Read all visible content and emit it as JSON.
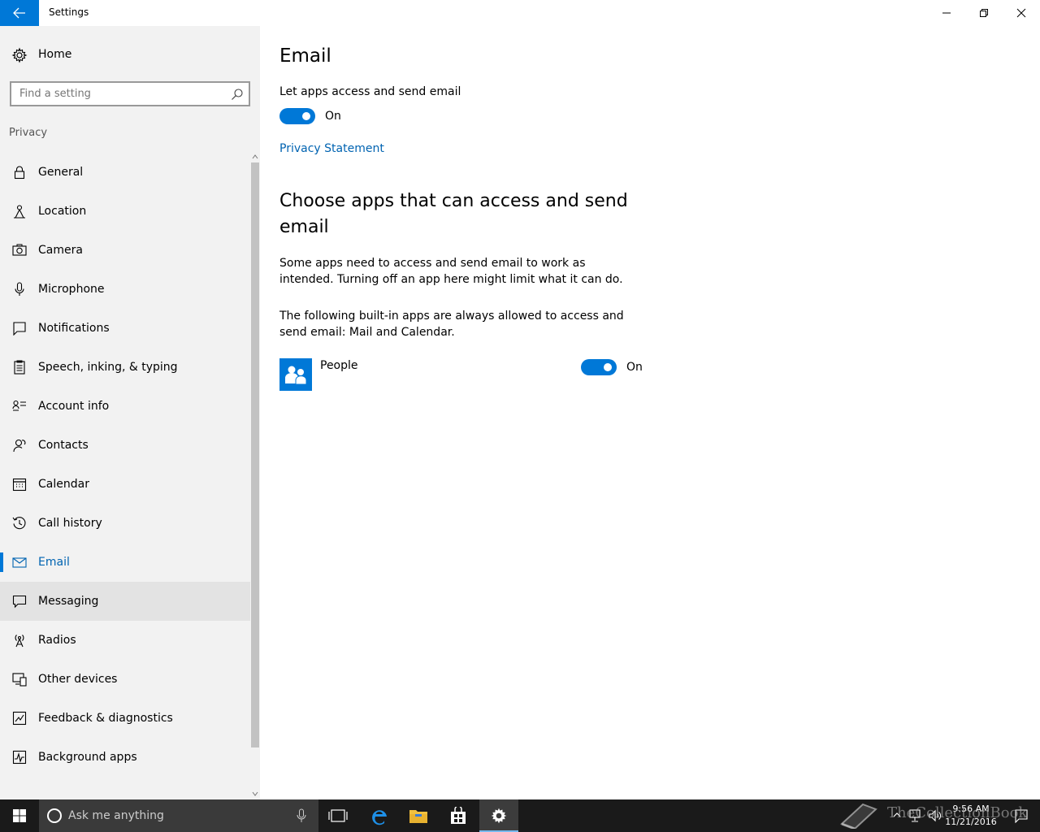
{
  "window": {
    "title": "Settings"
  },
  "sidebar": {
    "home_label": "Home",
    "search_placeholder": "Find a setting",
    "section_label": "Privacy",
    "items": [
      {
        "label": "General",
        "icon": "lock-icon"
      },
      {
        "label": "Location",
        "icon": "location-icon"
      },
      {
        "label": "Camera",
        "icon": "camera-icon"
      },
      {
        "label": "Microphone",
        "icon": "microphone-icon"
      },
      {
        "label": "Notifications",
        "icon": "notifications-icon"
      },
      {
        "label": "Speech, inking, & typing",
        "icon": "speech-icon"
      },
      {
        "label": "Account info",
        "icon": "account-info-icon"
      },
      {
        "label": "Contacts",
        "icon": "contacts-icon"
      },
      {
        "label": "Calendar",
        "icon": "calendar-icon"
      },
      {
        "label": "Call history",
        "icon": "call-history-icon"
      },
      {
        "label": "Email",
        "icon": "email-icon"
      },
      {
        "label": "Messaging",
        "icon": "messaging-icon"
      },
      {
        "label": "Radios",
        "icon": "radios-icon"
      },
      {
        "label": "Other devices",
        "icon": "other-devices-icon"
      },
      {
        "label": "Feedback & diagnostics",
        "icon": "feedback-icon"
      },
      {
        "label": "Background apps",
        "icon": "background-apps-icon"
      }
    ],
    "active_item": "Email",
    "hover_item": "Messaging"
  },
  "main": {
    "title": "Email",
    "let_apps_label": "Let apps access and send email",
    "let_apps_state": "On",
    "privacy_link": "Privacy Statement",
    "choose_title": "Choose apps that can access and send email",
    "description": "Some apps need to access and send email to work as intended. Turning off an app here might limit what it can do.",
    "builtin_note": "The following built-in apps are always allowed to access and send email: Mail and Calendar.",
    "apps": [
      {
        "name": "People",
        "state": "On"
      }
    ]
  },
  "taskbar": {
    "search_text": "Ask me anything",
    "time": "9:56 AM",
    "date": "11/21/2016",
    "watermark": "TheCollectionBook"
  },
  "colors": {
    "accent": "#0078d7",
    "link": "#0063b1",
    "sidebar_bg": "#f2f2f2",
    "taskbar_bg": "#1a1a1a"
  }
}
